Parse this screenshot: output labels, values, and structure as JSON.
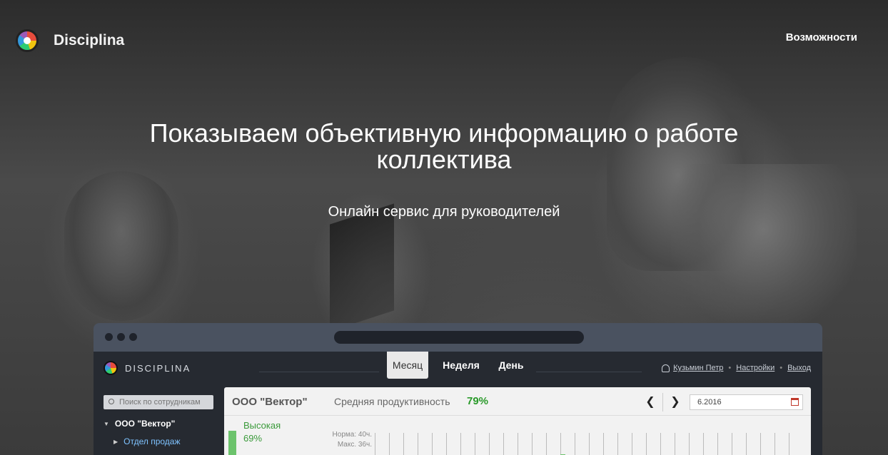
{
  "header": {
    "brand": "Disciplina",
    "nav_link": "Возможности"
  },
  "hero": {
    "title": "Показываем объективную информацию о работе коллектива",
    "subtitle": "Онлайн сервис для руководителей"
  },
  "app": {
    "brand": "Disciplina",
    "tabs": [
      {
        "label": "Месяц",
        "active": true
      },
      {
        "label": "Неделя",
        "active": false
      },
      {
        "label": "День",
        "active": false
      }
    ],
    "user_name": "Кузьмин Петр",
    "settings_link": "Настройки",
    "logout_link": "Выход",
    "search_placeholder": "Поиск по сотрудникам",
    "tree": {
      "org": "ООО \"Вектор\"",
      "department": "Отдел продаж"
    },
    "panel": {
      "org_name": "ООО \"Вектор\"",
      "avg_label": "Средняя продуктивность",
      "avg_value": "79%",
      "date": "6.2016",
      "level_label": "Высокая",
      "level_pct": "69%",
      "norm": "Норма: 40ч.",
      "max": "Макс. 36ч."
    }
  },
  "colors": {
    "accent_green": "#2a9a2a",
    "link_blue": "#7fc3ff"
  },
  "icons": [
    "logo-icon",
    "user-icon",
    "search-icon",
    "chevron-left-icon",
    "chevron-right-icon",
    "calendar-icon"
  ]
}
